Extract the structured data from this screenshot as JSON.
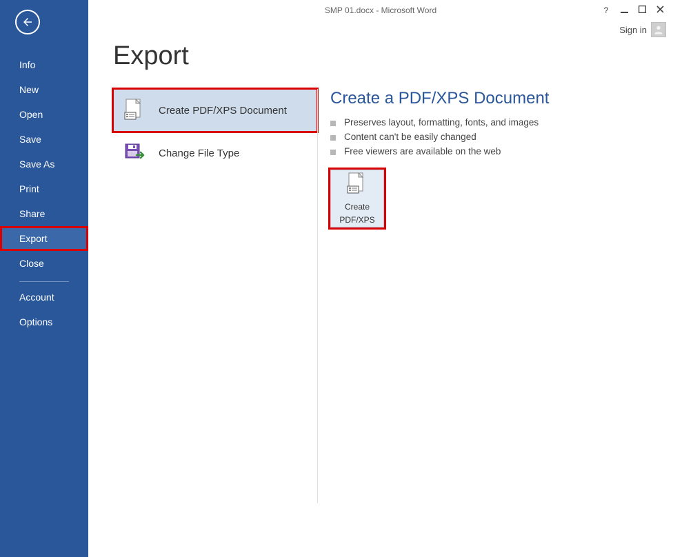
{
  "titlebar": {
    "title": "SMP 01.docx - Microsoft Word",
    "help": "?",
    "signin": "Sign in"
  },
  "sidebar": {
    "items": [
      {
        "label": "Info"
      },
      {
        "label": "New"
      },
      {
        "label": "Open"
      },
      {
        "label": "Save"
      },
      {
        "label": "Save As"
      },
      {
        "label": "Print"
      },
      {
        "label": "Share"
      },
      {
        "label": "Export"
      },
      {
        "label": "Close"
      }
    ],
    "footer": [
      {
        "label": "Account"
      },
      {
        "label": "Options"
      }
    ]
  },
  "page": {
    "title": "Export",
    "options": [
      {
        "label": "Create PDF/XPS Document"
      },
      {
        "label": "Change File Type"
      }
    ],
    "detail": {
      "title": "Create a PDF/XPS Document",
      "bullets": [
        "Preserves layout, formatting, fonts, and images",
        "Content can't be easily changed",
        "Free viewers are available on the web"
      ],
      "button_line1": "Create",
      "button_line2": "PDF/XPS"
    }
  }
}
